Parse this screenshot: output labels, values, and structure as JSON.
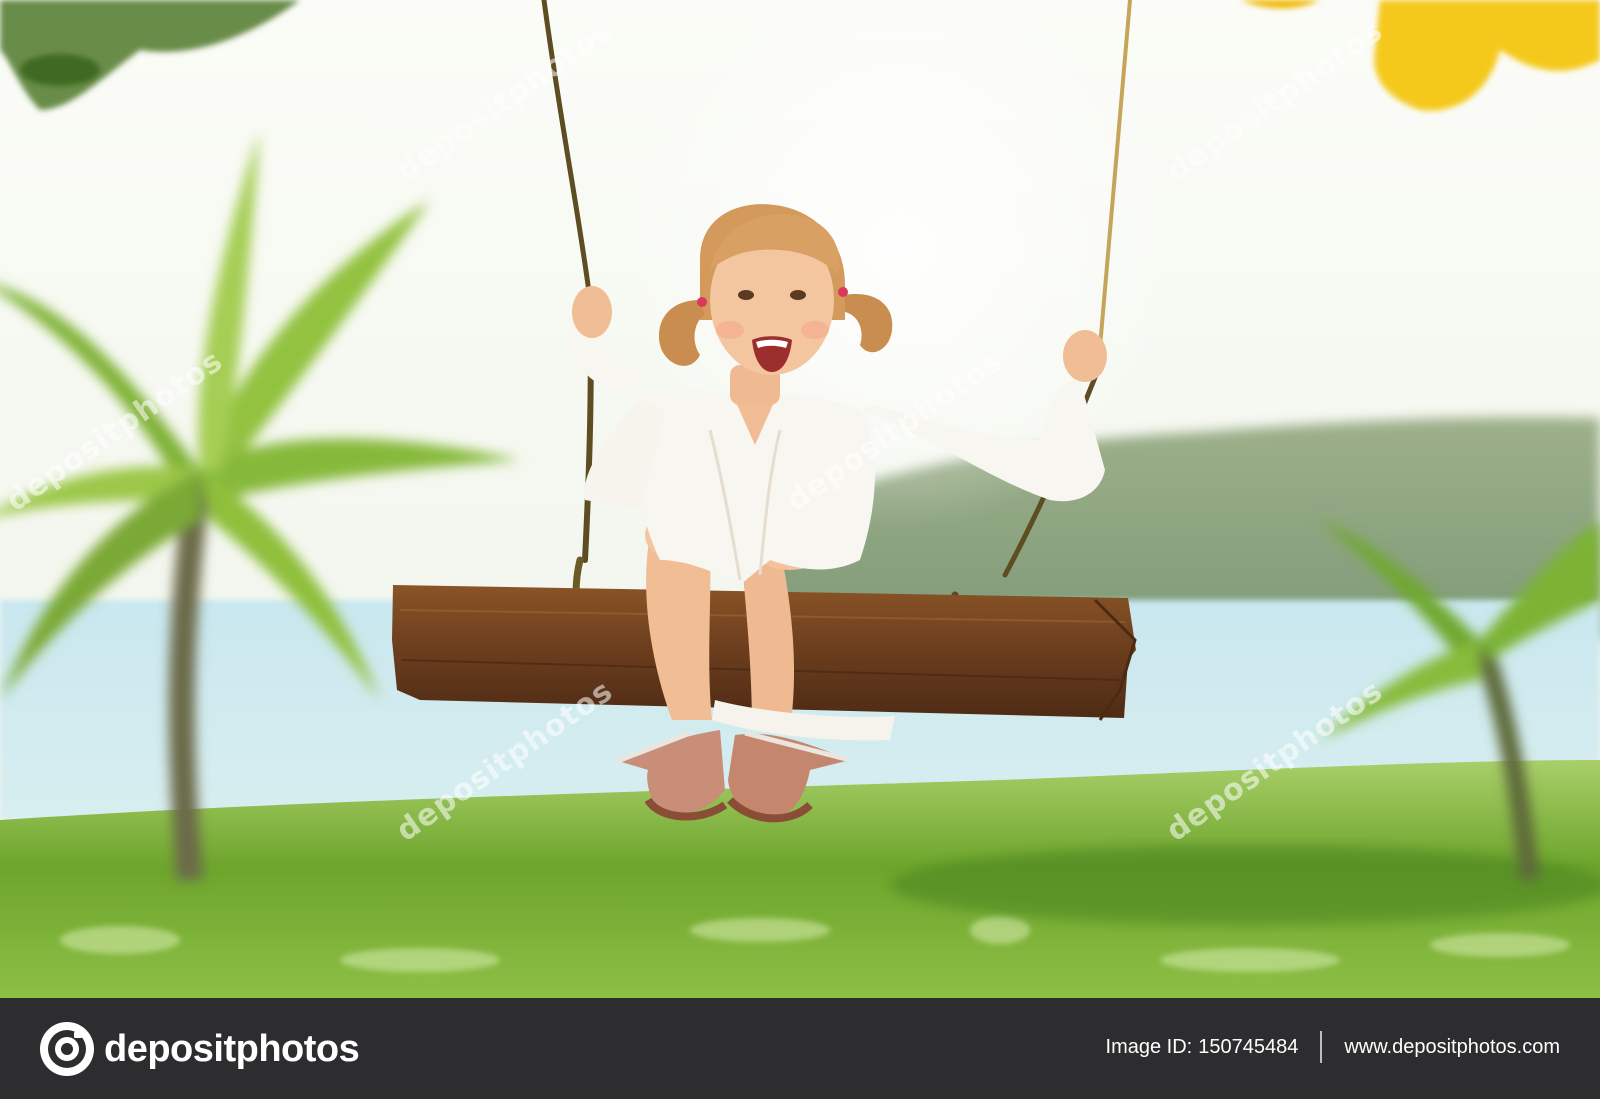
{
  "photo": {
    "watermark_text": "depositphotos",
    "colors": {
      "sky": "#f4f6ee",
      "water": "#bfe3ee",
      "grass": "#6fae2f",
      "palm": "#8fbf3a",
      "seat": "#6b3d1e",
      "rope": "#6a5a2a",
      "dress": "#f8f6f0",
      "hair": "#d9a063",
      "skin": "#f2c09a",
      "leaves_yellow": "#f5c91a"
    }
  },
  "footer": {
    "brand": "depositphotos",
    "image_id_label": "Image ID:",
    "image_id": "150745484",
    "site_url": "www.depositphotos.com",
    "background": "#2d2d2f"
  }
}
